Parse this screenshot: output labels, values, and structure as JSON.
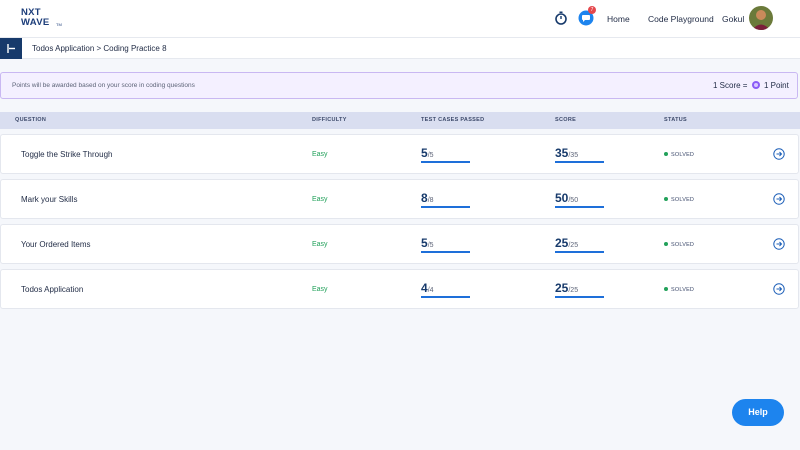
{
  "header": {
    "logo_line1": "NXT",
    "logo_line2": "WAVE",
    "logo_tm": "TM",
    "notification_count": "7",
    "nav": {
      "home": "Home",
      "playground": "Code Playground",
      "user": "Gokul"
    }
  },
  "breadcrumb": "Todos Application > Coding Practice 8",
  "info_banner": {
    "text": "Points will be awarded based on your score in coding questions",
    "score_label": "1 Score =",
    "point_label": "1 Point"
  },
  "columns": {
    "question": "QUESTION",
    "difficulty": "DIFFICULTY",
    "test_cases": "TEST CASES PASSED",
    "score": "SCORE",
    "status": "STATUS"
  },
  "rows": [
    {
      "question": "Toggle the Strike Through",
      "difficulty": "Easy",
      "passed": "5",
      "total_cases": "/5",
      "score": "35",
      "max_score": "/35",
      "status": "SOLVED"
    },
    {
      "question": "Mark your Skills",
      "difficulty": "Easy",
      "passed": "8",
      "total_cases": "/8",
      "score": "50",
      "max_score": "/50",
      "status": "SOLVED"
    },
    {
      "question": "Your Ordered Items",
      "difficulty": "Easy",
      "passed": "5",
      "total_cases": "/5",
      "score": "25",
      "max_score": "/25",
      "status": "SOLVED"
    },
    {
      "question": "Todos Application",
      "difficulty": "Easy",
      "passed": "4",
      "total_cases": "/4",
      "score": "25",
      "max_score": "/25",
      "status": "SOLVED"
    }
  ],
  "help_label": "Help",
  "colors": {
    "accent": "#1d84ee",
    "brand": "#173a6b",
    "success": "#22a15a",
    "banner_border": "#c9b8f2"
  }
}
